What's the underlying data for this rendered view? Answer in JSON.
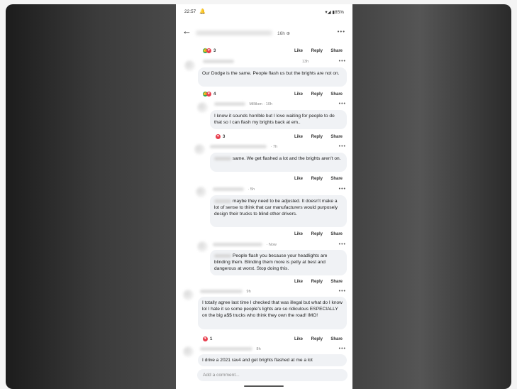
{
  "status": {
    "time": "22:57",
    "bell_icon": "bell-icon",
    "right": "▾◢ ▮85%"
  },
  "header": {
    "time": "16h",
    "globe": "⊕",
    "more": "•••",
    "back": "←"
  },
  "actions": {
    "like": "Like",
    "reply": "Reply",
    "share": "Share"
  },
  "reactions": [
    "3",
    "4",
    "3",
    "1"
  ],
  "meta": [
    "13h",
    "Milliken · 10h",
    "· 7h",
    "· 5h",
    "· Now",
    "9h",
    "8h"
  ],
  "comments": [
    "Our Dodge is the same. People flash us but the brights are not on.",
    "I know it sounds horrible but I love waiting for people to do that so I can flash my brights back at em..",
    "same. We get flashed a lot and the brights aren't on.",
    "maybe they need to be adjusted. It doesn't make a lot of sense to think that car manufacturers would purposely design their trucks to blind other drivers.",
    "People flash you because your headlights are blinding them. Blinding them more is petty at best and dangerous at worst. Stop doing this.",
    "I totally agree last time I checked that was illegal but what do I know lol I hate it so some people's lights are so ridiculous ESPECIALLY on the big a$$ trucks who think they own the road! IMO!",
    "I drive a 2021 rav4 and get brights flashed at me a lot"
  ],
  "composer": {
    "placeholder": "Add a comment..."
  },
  "colors": {
    "like_green": "#36a852",
    "love_red": "#e8404f",
    "bubble": "#f0f2f5"
  }
}
